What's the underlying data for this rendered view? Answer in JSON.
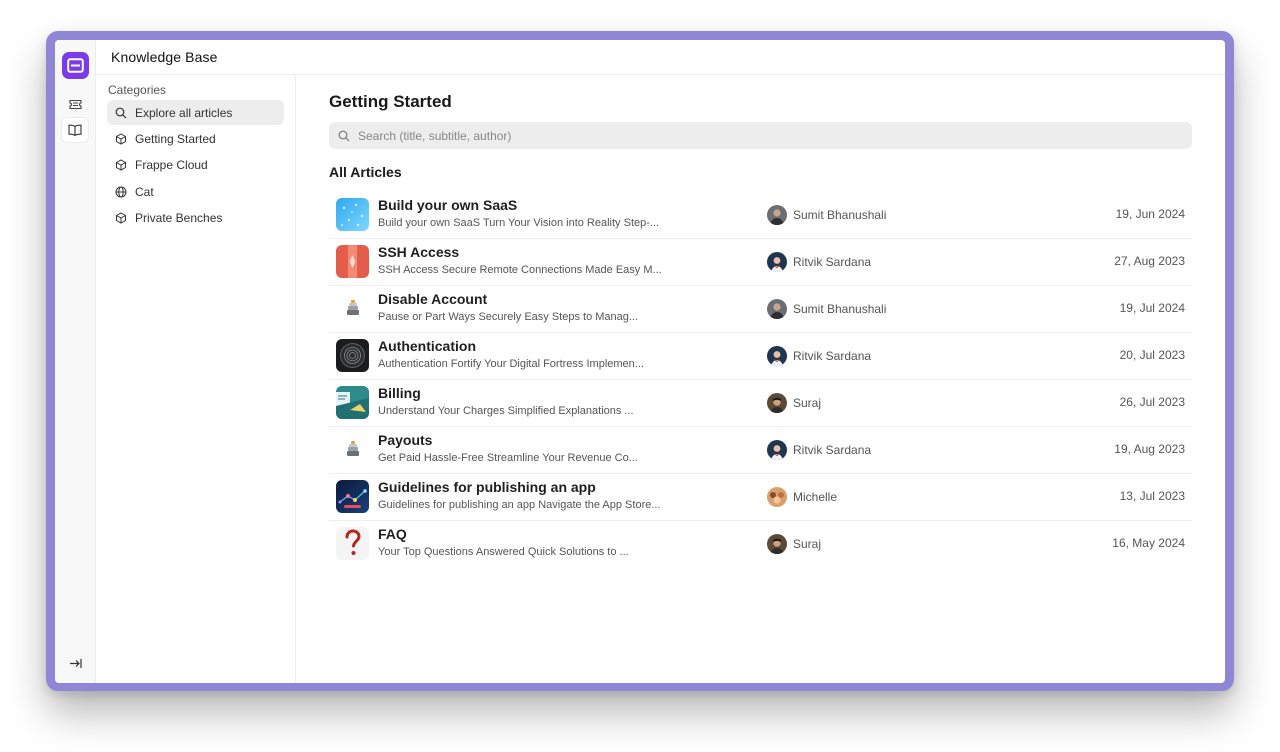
{
  "app": {
    "title": "Knowledge Base",
    "accent": "#7c3aed",
    "frame_color": "#8f87d6"
  },
  "rail": {
    "items": [
      {
        "name": "tickets-icon"
      },
      {
        "name": "book-icon"
      }
    ],
    "logout_icon": "logout-icon"
  },
  "sidebar": {
    "heading": "Categories",
    "items": [
      {
        "label": "Explore all articles",
        "icon": "search-icon",
        "active": true
      },
      {
        "label": "Getting Started",
        "icon": "cube-icon"
      },
      {
        "label": "Frappe Cloud",
        "icon": "cube-icon"
      },
      {
        "label": "Cat",
        "icon": "globe-icon"
      },
      {
        "label": "Private Benches",
        "icon": "cube-icon"
      }
    ]
  },
  "main": {
    "title": "Getting Started",
    "search_placeholder": "Search (title, subtitle, author)",
    "section_title": "All Articles",
    "articles": [
      {
        "title": "Build your own SaaS",
        "subtitle": "Build your own SaaS Turn Your Vision into Reality Step-...",
        "author": "Sumit Bhanushali",
        "date": "19, Jun 2024",
        "thumb": "blue-sparkle-thumbnail"
      },
      {
        "title": "SSH Access",
        "subtitle": "SSH Access Secure Remote Connections Made Easy M...",
        "author": "Ritvik Sardana",
        "date": "27, Aug 2023",
        "thumb": "red-lock-thumbnail"
      },
      {
        "title": "Disable Account",
        "subtitle": "Pause or Part Ways Securely Easy Steps to Manag...",
        "author": "Sumit Bhanushali",
        "date": "19, Jul 2024",
        "thumb": "stack-thumbnail"
      },
      {
        "title": "Authentication",
        "subtitle": "Authentication Fortify Your Digital Fortress Implemen...",
        "author": "Ritvik Sardana",
        "date": "20, Jul 2023",
        "thumb": "fingerprint-thumbnail"
      },
      {
        "title": "Billing",
        "subtitle": "Understand Your Charges Simplified Explanations ...",
        "author": "Suraj",
        "date": "26, Jul 2023",
        "thumb": "invoice-thumbnail"
      },
      {
        "title": "Payouts",
        "subtitle": "Get Paid Hassle-Free Streamline Your Revenue Co...",
        "author": "Ritvik Sardana",
        "date": "19, Aug 2023",
        "thumb": "stack-thumbnail"
      },
      {
        "title": "Guidelines for publishing an app",
        "subtitle": "Guidelines for publishing an app Navigate the App Store...",
        "author": "Michelle",
        "date": "13, Jul 2023",
        "thumb": "network-thumbnail"
      },
      {
        "title": "FAQ",
        "subtitle": "Your Top Questions Answered Quick Solutions to ...",
        "author": "Suraj",
        "date": "16, May 2024",
        "thumb": "question-thumbnail"
      }
    ]
  }
}
